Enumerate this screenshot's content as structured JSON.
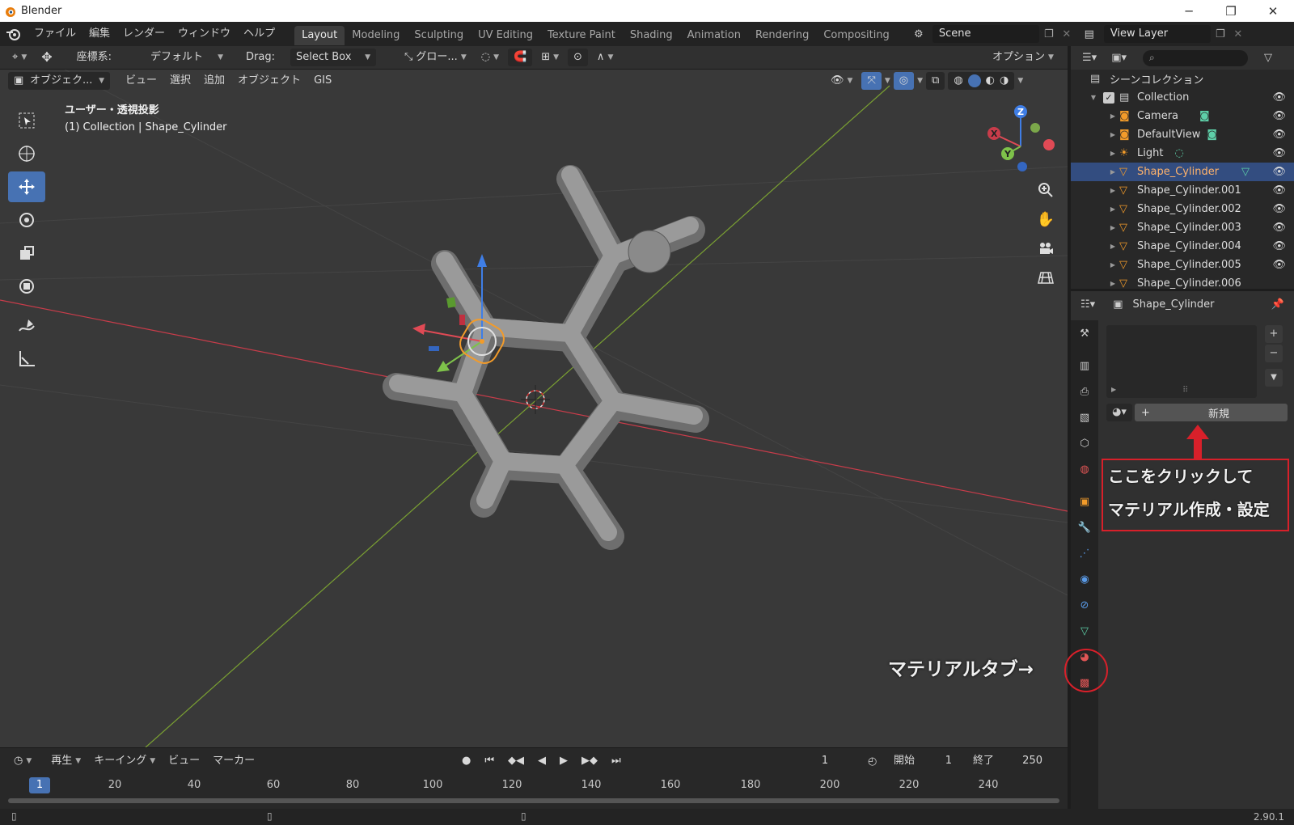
{
  "window": {
    "title": "Blender",
    "controls": [
      "─",
      "❐",
      "✕"
    ]
  },
  "menubar": {
    "menus": [
      "ファイル",
      "編集",
      "レンダー",
      "ウィンドウ",
      "ヘルプ"
    ],
    "workspaces": [
      "Layout",
      "Modeling",
      "Sculpting",
      "UV Editing",
      "Texture Paint",
      "Shading",
      "Animation",
      "Rendering",
      "Compositing"
    ],
    "active_workspace": "Layout",
    "scene": "Scene",
    "view_layer": "View Layer"
  },
  "tool_header": {
    "coord_label": "座標系:",
    "coord_value": "デフォルト",
    "drag_label": "Drag:",
    "drag_value": "Select Box",
    "transform_orientation": "グロー...",
    "options": "オプション"
  },
  "viewport_header": {
    "mode": "オブジェク...",
    "menus": [
      "ビュー",
      "選択",
      "追加",
      "オブジェクト",
      "GIS"
    ]
  },
  "viewport": {
    "view_name": "ユーザー・透視投影",
    "active": "(1) Collection | Shape_Cylinder"
  },
  "outliner": {
    "root": "シーンコレクション",
    "collection": "Collection",
    "items": [
      {
        "name": "Camera",
        "type": "camera"
      },
      {
        "name": "DefaultView",
        "type": "camera"
      },
      {
        "name": "Light",
        "type": "light"
      },
      {
        "name": "Shape_Cylinder",
        "type": "mesh",
        "selected": true
      },
      {
        "name": "Shape_Cylinder.001",
        "type": "mesh"
      },
      {
        "name": "Shape_Cylinder.002",
        "type": "mesh"
      },
      {
        "name": "Shape_Cylinder.003",
        "type": "mesh"
      },
      {
        "name": "Shape_Cylinder.004",
        "type": "mesh"
      },
      {
        "name": "Shape_Cylinder.005",
        "type": "mesh"
      },
      {
        "name": "Shape_Cylinder.006",
        "type": "mesh"
      }
    ]
  },
  "properties": {
    "object_name": "Shape_Cylinder",
    "new_button": "新規"
  },
  "annotations": {
    "line1": "ここをクリックして",
    "line2": "マテリアル作成・設定",
    "tab_label": "マテリアルタブ→"
  },
  "timeline": {
    "menus": [
      "再生",
      "キーイング",
      "ビュー",
      "マーカー"
    ],
    "current_frame": "1",
    "start_label": "開始",
    "start": "1",
    "end_label": "終了",
    "end": "250",
    "ticks": [
      "20",
      "40",
      "60",
      "80",
      "100",
      "120",
      "140",
      "160",
      "180",
      "200",
      "220",
      "240"
    ],
    "cursor_frame": "1"
  },
  "status": {
    "version": "2.90.1"
  },
  "colors": {
    "accent": "#4772b3",
    "selected_row": "#334d80",
    "annotation_red": "#d8202a",
    "x_axis": "#c83c4a",
    "y_axis": "#7aa032"
  }
}
